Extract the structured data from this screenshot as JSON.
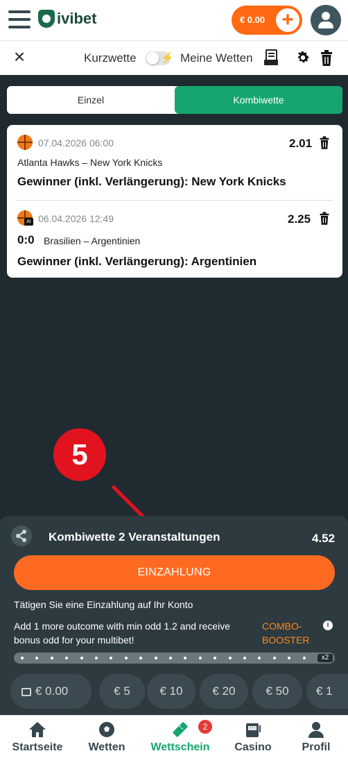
{
  "header": {
    "brand": "ivibet",
    "balance": "€ 0.00"
  },
  "subbar": {
    "quick_bet_label": "Kurzwette",
    "my_bets_label": "Meine Wetten"
  },
  "tabs": [
    {
      "label": "Einzel",
      "active": false
    },
    {
      "label": "Kombiwette",
      "active": true
    }
  ],
  "bets": [
    {
      "date": "07.04.2026 06:00",
      "odd": "2.01",
      "match": "Atlanta Hawks – New York Knicks",
      "score": "",
      "selection": "Gewinner (inkl. Verlängerung): New York Knicks",
      "sport_icon": "basketball-icon",
      "ai_badge": ""
    },
    {
      "date": "06.04.2026 12:49",
      "odd": "2.25",
      "match": "Brasilien – Argentinien",
      "score": "0:0",
      "selection": "Gewinner (inkl. Verlängerung): Argentinien",
      "sport_icon": "basketball-icon",
      "ai_badge": "AI"
    }
  ],
  "annotation": {
    "step_number": "5",
    "color": "#e1131e"
  },
  "betslip": {
    "title": "Kombiwette 2 Veranstaltungen",
    "total_odd": "4.52",
    "deposit_button": "EINZAHLUNG",
    "deposit_hint": "Tätigen Sie eine Einzahlung auf Ihr Konto",
    "booster_text": "Add 1 more outcome with min odd 1.2 and receive bonus odd for your multibet!",
    "booster_label": "COMBO-BOOSTER",
    "booster_multiplier": "x2",
    "stake_chips": [
      "€ 0.00",
      "€ 5",
      "€ 10",
      "€ 20",
      "€ 50",
      "€ 1"
    ]
  },
  "navbar": {
    "items": [
      {
        "label": "Startseite",
        "icon": "home-icon",
        "active": false
      },
      {
        "label": "Wetten",
        "icon": "soccer-ball-icon",
        "active": false
      },
      {
        "label": "Wettschein",
        "icon": "ticket-icon",
        "active": true,
        "badge": "2"
      },
      {
        "label": "Casino",
        "icon": "slot-machine-icon",
        "active": false
      },
      {
        "label": "Profil",
        "icon": "user-icon",
        "active": false
      }
    ]
  },
  "colors": {
    "accent_green": "#16a56e",
    "accent_orange": "#ff6a22",
    "background_dark": "#1f2b30",
    "panel_dark": "#2d3a40"
  }
}
